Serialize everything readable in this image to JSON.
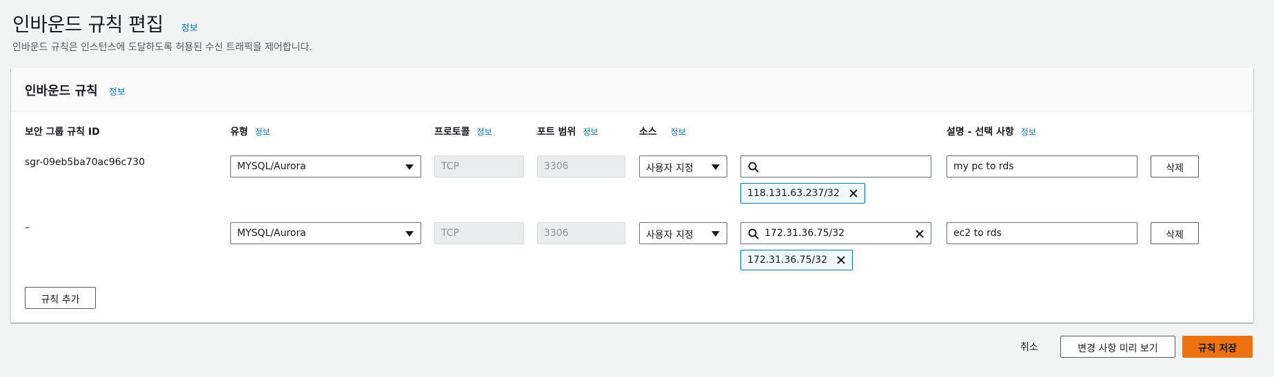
{
  "page": {
    "title": "인바운드 규칙 편집",
    "title_info": "정보",
    "description": "인바운드 규칙은 인스턴스에 도달하도록 허용된 수신 트래픽을 제어합니다."
  },
  "panel": {
    "title": "인바운드 규칙",
    "title_info": "정보",
    "columns": {
      "rule_id": "보안 그룹 규칙 ID",
      "type": "유형",
      "type_info": "정보",
      "protocol": "프로토콜",
      "protocol_info": "정보",
      "port_range": "포트 범위",
      "port_range_info": "정보",
      "source": "소스",
      "source_info": "정보",
      "description": "설명 - 선택 사항",
      "description_info": "정보"
    },
    "rules": [
      {
        "id": "sgr-09eb5ba70ac96c730",
        "type": "MYSQL/Aurora",
        "protocol": "TCP",
        "port": "3306",
        "source_type": "사용자 지정",
        "search_value": "",
        "token": "118.131.63.237/32",
        "description": "my pc to rds",
        "delete_label": "삭제"
      },
      {
        "id": "–",
        "type": "MYSQL/Aurora",
        "protocol": "TCP",
        "port": "3306",
        "source_type": "사용자 지정",
        "search_value": "172.31.36.75/32",
        "token": "172.31.36.75/32",
        "description": "ec2 to rds",
        "delete_label": "삭제"
      }
    ],
    "add_rule_label": "규칙 추가"
  },
  "footer": {
    "cancel_label": "취소",
    "preview_label": "변경 사항 미리 보기",
    "save_label": "규칙 저장"
  },
  "colors": {
    "primary": "#ec7211",
    "link": "#0073bb",
    "token_border": "#0073bb"
  }
}
